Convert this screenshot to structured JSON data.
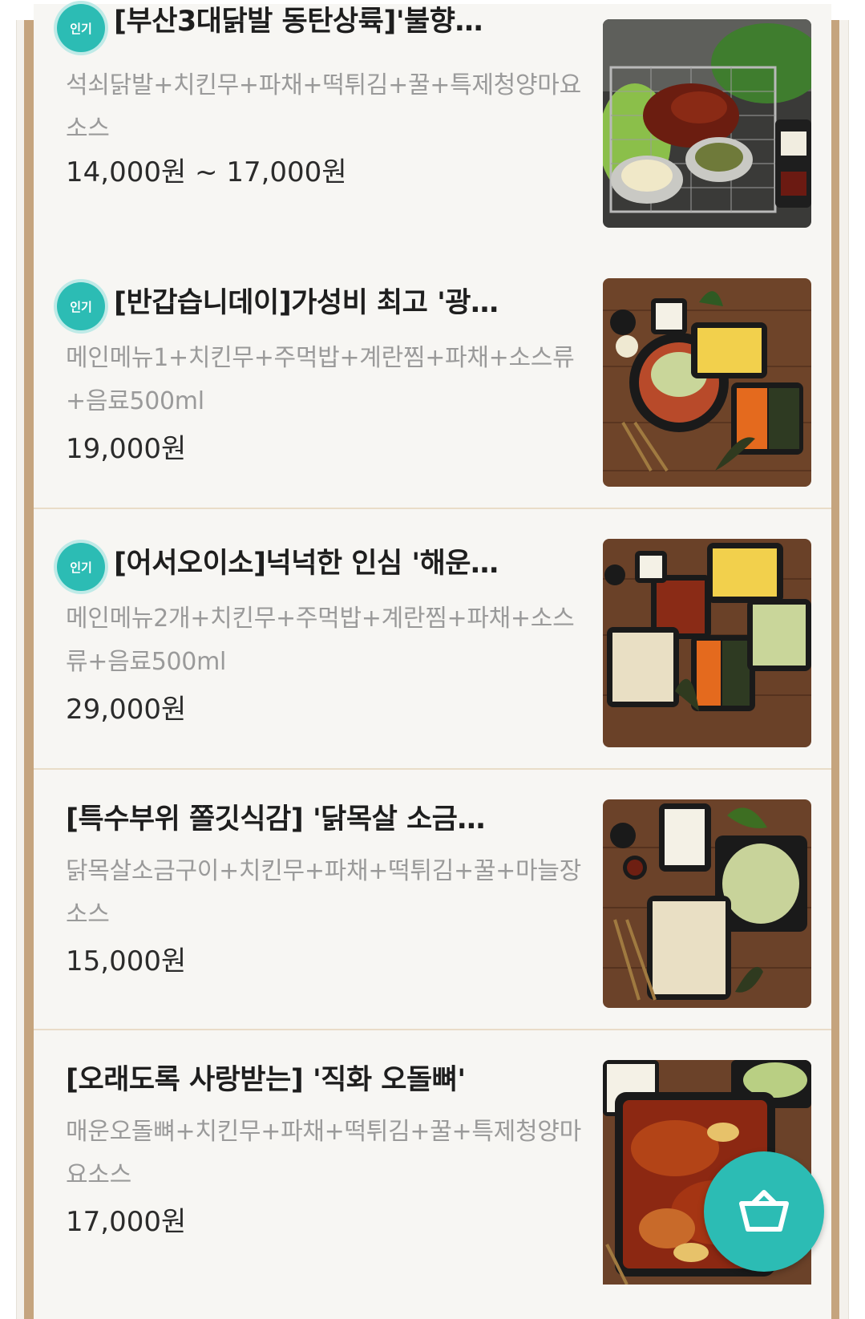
{
  "menu": {
    "items": [
      {
        "popular": true,
        "badge": "인기",
        "title": "[부산3대닭발 동탄상륙]'불향…",
        "description": "석쇠닭발+치킨무+파채+떡튀김+꿀+특제청양마요소스",
        "price": "14,000원 ~ 17,000원",
        "image_icon": "grilled-chicken-feet-photo"
      },
      {
        "popular": true,
        "badge": "인기",
        "title": "[반갑습니데이]가성비 최고 '광…",
        "description": "메인메뉴1+치킨무+주먹밥+계란찜+파채+소스류+음료500ml",
        "price": "19,000원",
        "image_icon": "set-meal-photo"
      },
      {
        "popular": true,
        "badge": "인기",
        "title": "[어서오이소]넉넉한 인심 '해운…",
        "description": "메인메뉴2개+치킨무+주먹밥+계란찜+파채+소스류+음료500ml",
        "price": "29,000원",
        "image_icon": "large-set-meal-photo"
      },
      {
        "popular": false,
        "badge": "",
        "title": "[특수부위 쫄깃식감] '닭목살 소금…",
        "description": "닭목살소금구이+치킨무+파채+떡튀김+꿀+마늘장소스",
        "price": "15,000원",
        "image_icon": "chicken-neck-salt-grill-photo"
      },
      {
        "popular": false,
        "badge": "",
        "title": "[오래도록 사랑받는] '직화 오돌뼈'",
        "description": "매운오돌뼈+치킨무+파채+떡튀김+꿀+특제청양마요소스",
        "price": "17,000원",
        "image_icon": "spicy-cartilage-photo"
      }
    ]
  },
  "cart_button": {
    "icon": "basket-icon"
  },
  "colors": {
    "accent": "#2cbcb4",
    "rail": "#c5a47e",
    "title": "#1e1e1e",
    "description": "#9a9a9a",
    "price": "#2b2b2b"
  }
}
